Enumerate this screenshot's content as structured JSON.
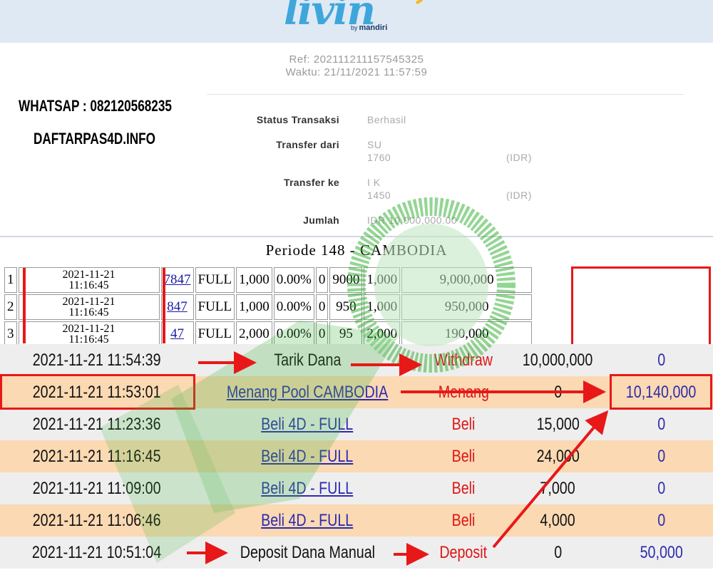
{
  "header": {
    "logo_text": "livin",
    "logo_by": "by",
    "logo_brand": "mandiri"
  },
  "receipt": {
    "ref": "Ref: 202111211157545325",
    "waktu": "Waktu: 21/11/2021 11:57:59",
    "status_label": "Status Transaksi",
    "status_value": "Berhasil",
    "from_label": "Transfer dari",
    "from_name": "SU",
    "from_account": "1760",
    "from_currency": "(IDR)",
    "to_label": "Transfer ke",
    "to_name": "I K",
    "to_account": "1450",
    "to_currency": "(IDR)",
    "amount_label": "Jumlah",
    "amount_value": "IDR 10,000,000.00"
  },
  "promo": {
    "whatsapp": "WHATSAP : 082120568235",
    "site": "DAFTARPAS4D.INFO"
  },
  "periode_title": "Periode 148 - CAMBODIA",
  "bets": [
    {
      "no": "1",
      "date": "2021-11-21",
      "time": "11:16:45",
      "number": "7847",
      "type": "FULL",
      "bet": "1,000",
      "disc": "0.00%",
      "zero": "0",
      "mult": "9000",
      "pay": "1,000",
      "win": "9,000,000"
    },
    {
      "no": "2",
      "date": "2021-11-21",
      "time": "11:16:45",
      "number": "847",
      "type": "FULL",
      "bet": "1,000",
      "disc": "0.00%",
      "zero": "0",
      "mult": "950",
      "pay": "1,000",
      "win": "950,000"
    },
    {
      "no": "3",
      "date": "2021-11-21",
      "time": "11:16:45",
      "number": "47",
      "type": "FULL",
      "bet": "2,000",
      "disc": "0.00%",
      "zero": "0",
      "mult": "95",
      "pay": "2,000",
      "win": "190,000"
    }
  ],
  "history": [
    {
      "datetime": "2021-11-21 11:54:39",
      "desc": "Tarik Dana",
      "desc_link": false,
      "type": "Withdraw",
      "debit": "10,000,000",
      "credit": "0"
    },
    {
      "datetime": "2021-11-21 11:53:01",
      "desc": "Menang Pool CAMBODIA",
      "desc_link": true,
      "type": "Menang",
      "debit": "0",
      "credit": "10,140,000"
    },
    {
      "datetime": "2021-11-21 11:23:36",
      "desc": "Beli 4D - FULL",
      "desc_link": true,
      "type": "Beli",
      "debit": "15,000",
      "credit": "0"
    },
    {
      "datetime": "2021-11-21 11:16:45",
      "desc": "Beli 4D - FULL",
      "desc_link": true,
      "type": "Beli",
      "debit": "24,000",
      "credit": "0"
    },
    {
      "datetime": "2021-11-21 11:09:00",
      "desc": "Beli 4D - FULL",
      "desc_link": true,
      "type": "Beli",
      "debit": "7,000",
      "credit": "0"
    },
    {
      "datetime": "2021-11-21 11:06:46",
      "desc": "Beli 4D - FULL",
      "desc_link": true,
      "type": "Beli",
      "debit": "4,000",
      "credit": "0"
    },
    {
      "datetime": "2021-11-21 10:51:04",
      "desc": "Deposit Dana Manual",
      "desc_link": false,
      "type": "Deposit",
      "debit": "0",
      "credit": "50,000"
    }
  ],
  "colors": {
    "highlight_red": "#e81818",
    "link_blue": "#2b2bb0",
    "row_odd": "#eeeeee",
    "row_even": "#fad9b3",
    "banner_bg": "#dfe9f3",
    "watermark_green": "#3db33d"
  }
}
